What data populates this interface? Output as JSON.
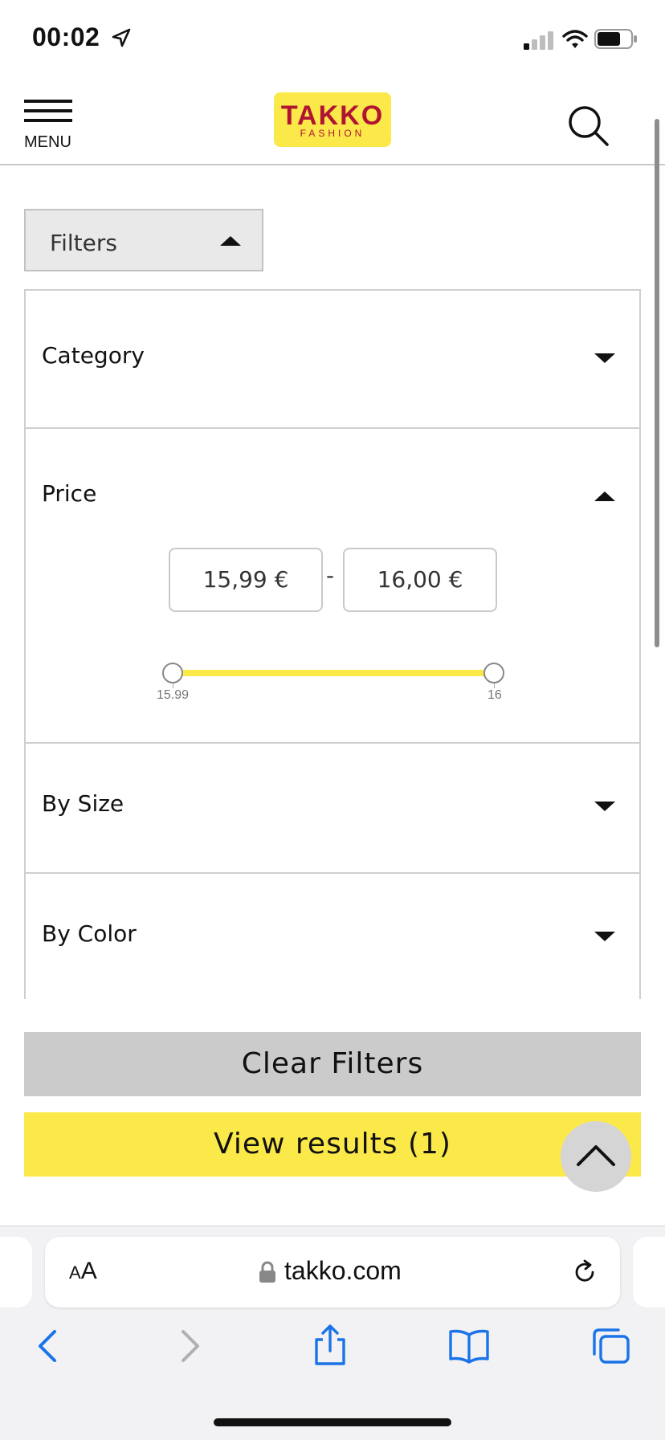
{
  "status_bar": {
    "time": "00:02"
  },
  "header": {
    "menu_label": "MENU",
    "logo_main": "TAKKO",
    "logo_sub": "FASHION"
  },
  "filters": {
    "toggle_label": "Filters",
    "sections": {
      "category": "Category",
      "price": "Price",
      "by_size": "By Size",
      "by_color": "By Color"
    },
    "price": {
      "min_value": "15,99 €",
      "separator": "-",
      "max_value": "16,00 €",
      "slider_min_label": "15.99",
      "slider_max_label": "16"
    }
  },
  "actions": {
    "clear_label": "Clear Filters",
    "view_results_label": "View results (1)"
  },
  "browser": {
    "text_size_label": "AA",
    "url": "takko.com"
  },
  "colors": {
    "brand_yellow": "#fbe94a",
    "brand_red": "#b01432",
    "clear_button": "#cbcbcb",
    "ios_blue": "#1a73e8"
  }
}
